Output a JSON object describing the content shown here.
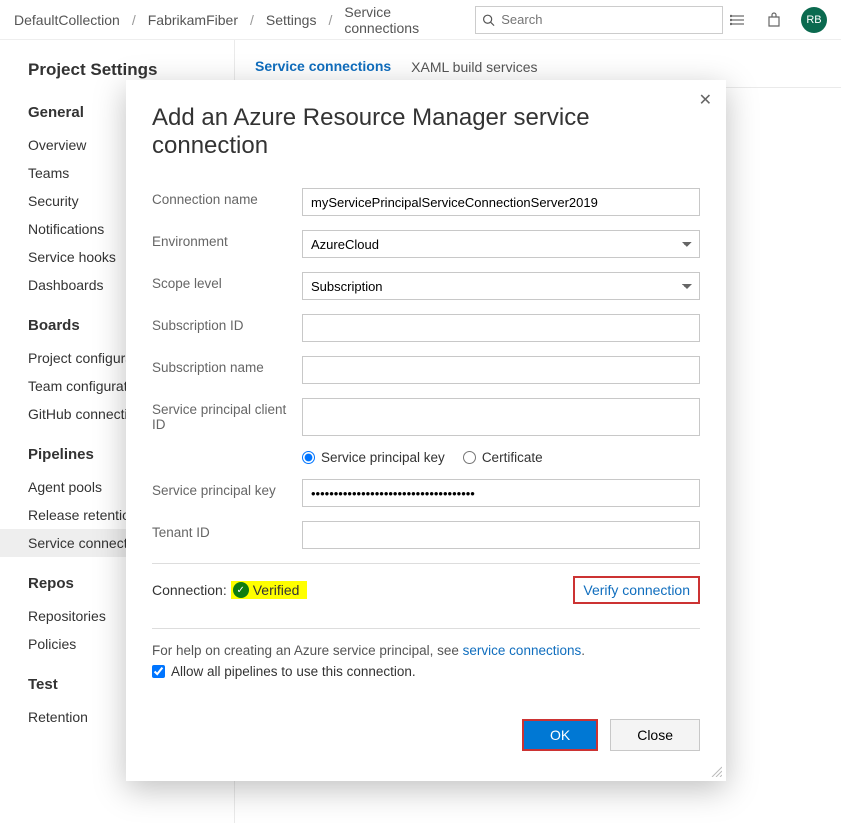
{
  "breadcrumbs": [
    "DefaultCollection",
    "FabrikamFiber",
    "Settings",
    "Service connections"
  ],
  "search": {
    "placeholder": "Search"
  },
  "avatar": "RB",
  "sidebar": {
    "title": "Project Settings",
    "sections": [
      {
        "label": "General",
        "items": [
          "Overview",
          "Teams",
          "Security",
          "Notifications",
          "Service hooks",
          "Dashboards"
        ]
      },
      {
        "label": "Boards",
        "items": [
          "Project configuration",
          "Team configuration",
          "GitHub connections"
        ]
      },
      {
        "label": "Pipelines",
        "items": [
          "Agent pools",
          "Release retention",
          "Service connections"
        ]
      },
      {
        "label": "Repos",
        "items": [
          "Repositories",
          "Policies"
        ]
      },
      {
        "label": "Test",
        "items": [
          "Retention"
        ]
      }
    ],
    "active": "Service connections"
  },
  "tabs": {
    "items": [
      "Service connections",
      "XAML build services"
    ],
    "active": "Service connections"
  },
  "modal": {
    "title": "Add an Azure Resource Manager service connection",
    "fields": {
      "connection_name": {
        "label": "Connection name",
        "value": "myServicePrincipalServiceConnectionServer2019"
      },
      "environment": {
        "label": "Environment",
        "value": "AzureCloud"
      },
      "scope_level": {
        "label": "Scope level",
        "value": "Subscription"
      },
      "subscription_id": {
        "label": "Subscription ID",
        "value": ""
      },
      "subscription_name": {
        "label": "Subscription name",
        "value": ""
      },
      "sp_client_id": {
        "label": "Service principal client ID",
        "value": ""
      },
      "auth_type": {
        "options": [
          "Service principal key",
          "Certificate"
        ],
        "selected": "Service principal key"
      },
      "sp_key": {
        "label": "Service principal key",
        "value": "••••••••••••••••••••••••••••••••••••"
      },
      "tenant_id": {
        "label": "Tenant ID",
        "value": ""
      }
    },
    "verification": {
      "label": "Connection:",
      "status": "Verified",
      "verify_button": "Verify connection"
    },
    "help": {
      "prefix": "For help on creating an Azure service principal, see ",
      "link": "service connections",
      "suffix": "."
    },
    "allow_all": {
      "label": "Allow all pipelines to use this connection.",
      "checked": true
    },
    "actions": {
      "ok": "OK",
      "close": "Close"
    }
  }
}
